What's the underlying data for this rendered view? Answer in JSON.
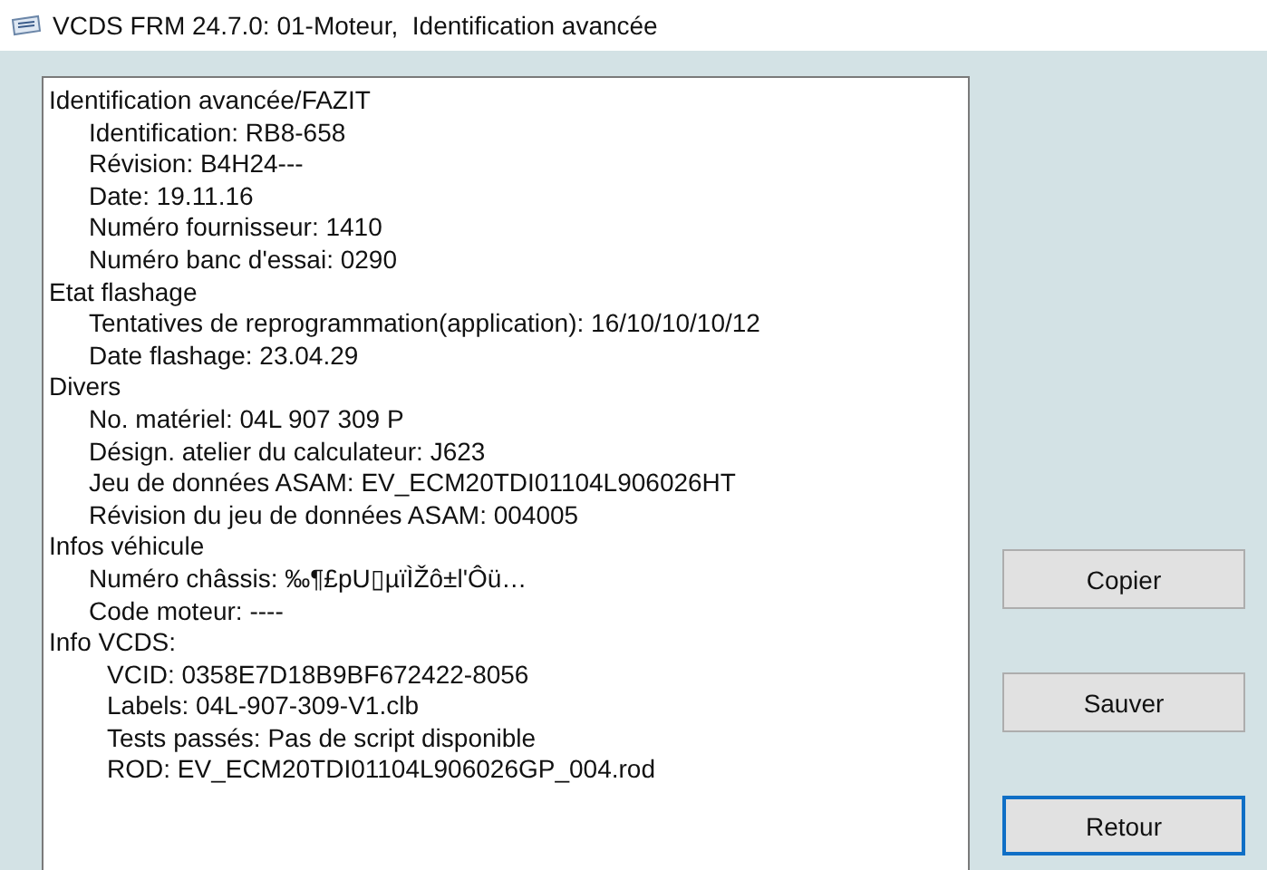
{
  "window": {
    "title": "VCDS FRM 24.7.0: 01-Moteur,  Identification avancée"
  },
  "sections": [
    {
      "title": "Identification avancée/FAZIT",
      "lines": [
        "Identification: RB8-658",
        "Révision: B4H24---",
        "Date: 19.11.16",
        "Numéro fournisseur: 1410",
        "Numéro banc d'essai: 0290"
      ],
      "deep_indent": false
    },
    {
      "title": "Etat flashage",
      "lines": [
        "Tentatives de reprogrammation(application): 16/10/10/10/12",
        "Date flashage: 23.04.29"
      ],
      "deep_indent": false
    },
    {
      "title": "Divers",
      "lines": [
        "No. matériel: 04L 907 309 P",
        "Désign. atelier du calculateur: J623",
        "Jeu de données ASAM: EV_ECM20TDI01104L906026HT",
        "Révision du jeu de données ASAM: 004005"
      ],
      "deep_indent": false
    },
    {
      "title": "Infos véhicule",
      "lines": [
        "Numéro châssis: ‰¶£pU▯µïÌŽô±l'Ôü…",
        "Code moteur: ----"
      ],
      "deep_indent": false
    },
    {
      "title": "Info VCDS:",
      "lines": [
        "VCID: 0358E7D18B9BF672422-8056",
        "Labels: 04L-907-309-V1.clb",
        "Tests passés: Pas de script disponible",
        "ROD: EV_ECM20TDI01104L906026GP_004.rod"
      ],
      "deep_indent": true
    }
  ],
  "buttons": [
    {
      "label": "Copier",
      "focused": false
    },
    {
      "label": "Sauver",
      "focused": false
    },
    {
      "label": "Retour",
      "focused": true
    }
  ]
}
